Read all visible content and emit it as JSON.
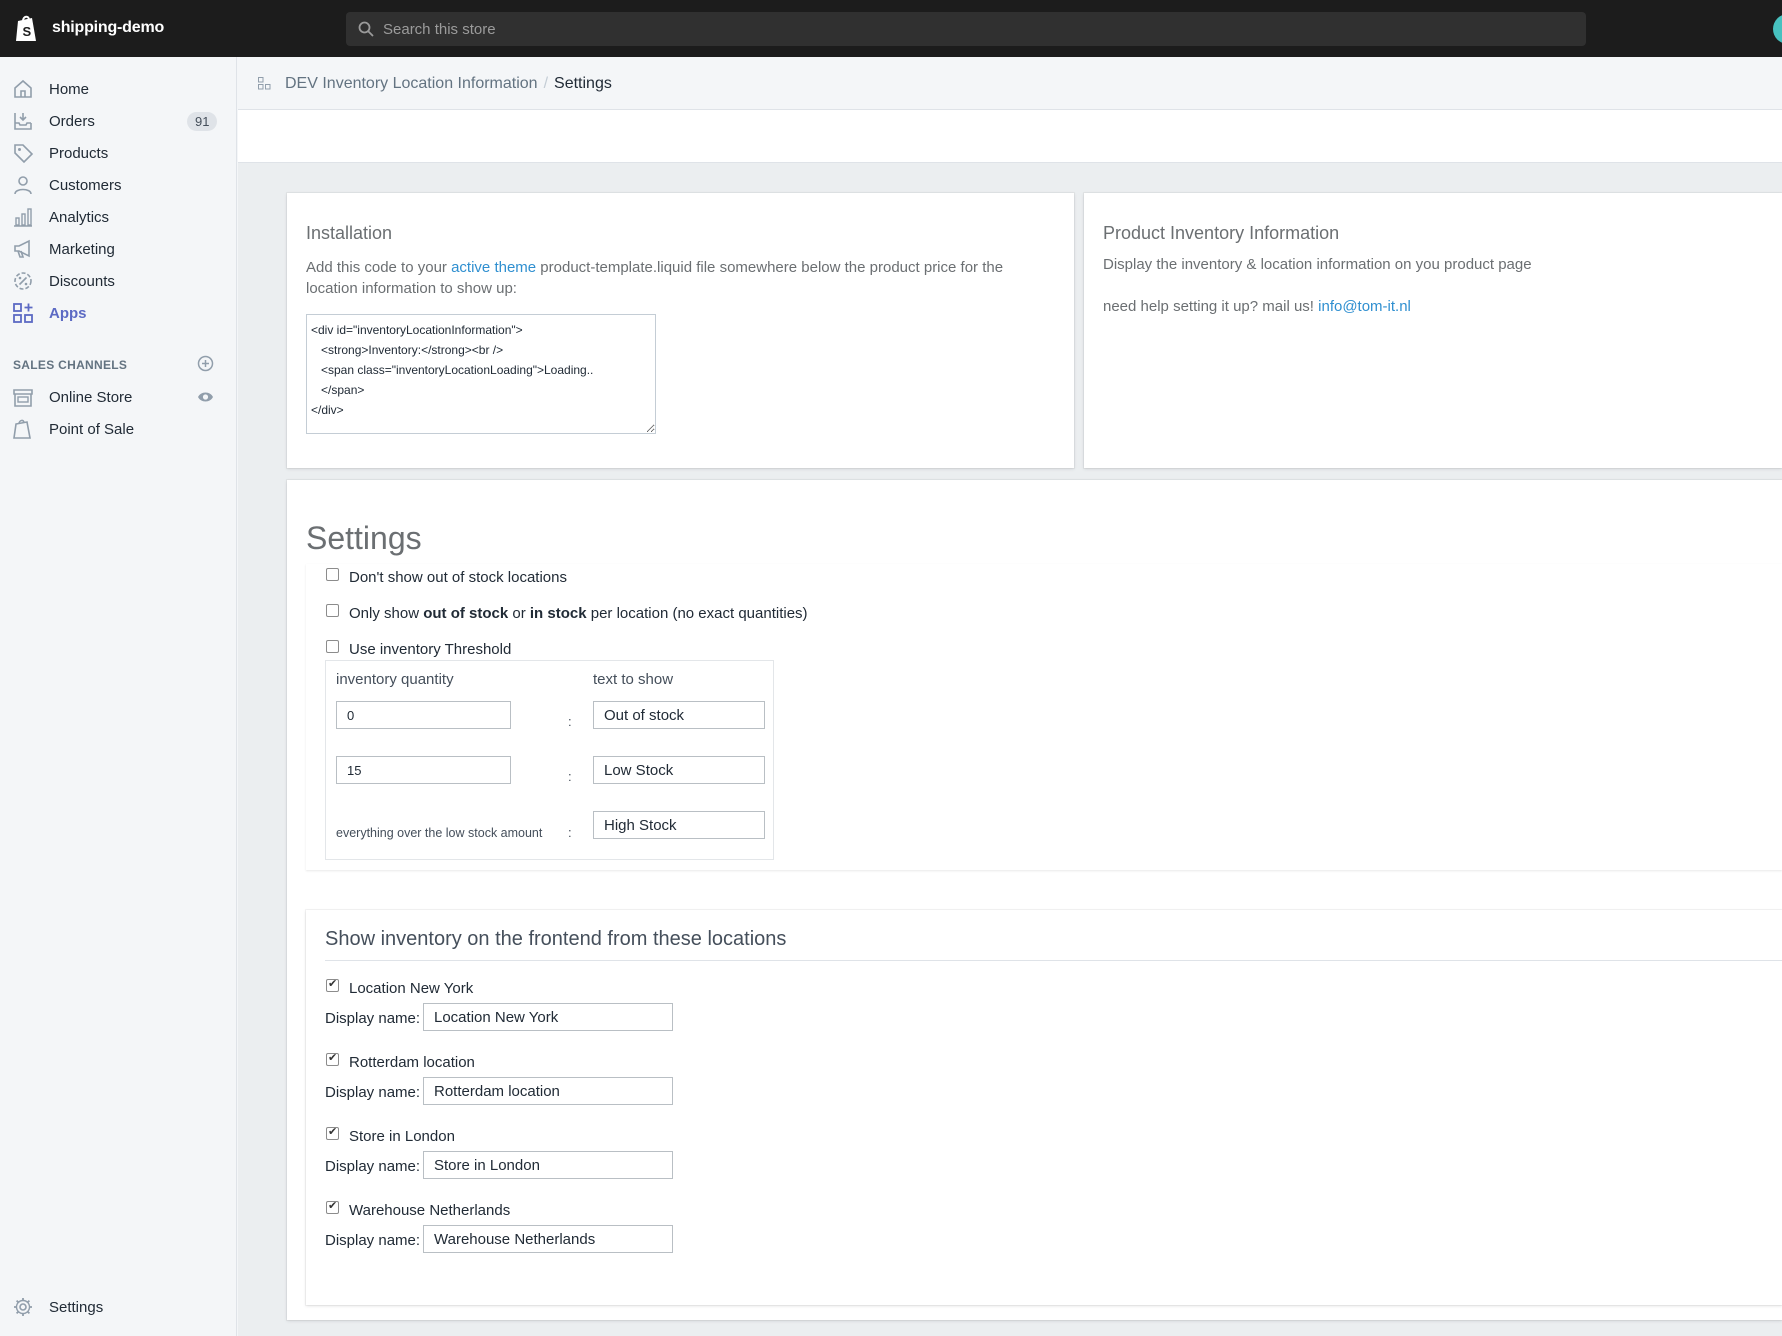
{
  "topbar": {
    "shop_name": "shipping-demo",
    "search_placeholder": "Search this store"
  },
  "sidebar": {
    "items": [
      {
        "label": "Home",
        "icon": "home-icon"
      },
      {
        "label": "Orders",
        "icon": "orders-icon",
        "badge": "91"
      },
      {
        "label": "Products",
        "icon": "tag-icon"
      },
      {
        "label": "Customers",
        "icon": "person-icon"
      },
      {
        "label": "Analytics",
        "icon": "bar-chart-icon"
      },
      {
        "label": "Marketing",
        "icon": "megaphone-icon"
      },
      {
        "label": "Discounts",
        "icon": "discount-icon"
      },
      {
        "label": "Apps",
        "icon": "apps-icon",
        "active": true
      }
    ],
    "sales_channels_heading": "SALES CHANNELS",
    "channels": [
      {
        "label": "Online Store",
        "icon": "store-icon"
      },
      {
        "label": "Point of Sale",
        "icon": "pos-bag-icon"
      }
    ],
    "settings_label": "Settings"
  },
  "breadcrumb": {
    "app": "DEV Inventory Location Information",
    "separator": "/",
    "current": "Settings"
  },
  "installation": {
    "title": "Installation",
    "text_before": "Add this code to your ",
    "link": "active theme",
    "text_after": " product-template.liquid file somewhere below the product price for the location information to show up:",
    "code": "<div id=\"inventoryLocationInformation\">\n   <strong>Inventory:</strong><br />\n   <span class=\"inventoryLocationLoading\">Loading..\n   </span>\n</div>"
  },
  "product_info": {
    "title": "Product Inventory Information",
    "description": "Display the inventory & location information on you product page",
    "help_text": "need help setting it up? mail us! ",
    "email": "info@tom-it.nl"
  },
  "settings": {
    "title": "Settings",
    "options": [
      {
        "label": "Don't show out of stock locations",
        "checked": false
      },
      {
        "parts": [
          "Only show ",
          "out of stock",
          " or ",
          "in stock",
          " per location (no exact quantities)"
        ],
        "checked": false
      },
      {
        "label": "Use inventory Threshold",
        "checked": false
      }
    ],
    "threshold": {
      "col_qty": "inventory quantity",
      "col_text": "text to show",
      "rows": [
        {
          "qty": "0",
          "text": "Out of stock"
        },
        {
          "qty": "15",
          "text": "Low Stock"
        }
      ],
      "over_label": "everything over the low stock amount",
      "over_text": "High Stock",
      "colon": ":"
    }
  },
  "locations": {
    "title": "Show inventory on the frontend from these locations",
    "display_name_label": "Display name:",
    "items": [
      {
        "name": "Location New York",
        "display_name": "Location New York",
        "checked": true
      },
      {
        "name": "Rotterdam location",
        "display_name": "Rotterdam location",
        "checked": true
      },
      {
        "name": "Store in London",
        "display_name": "Store in London",
        "checked": true
      },
      {
        "name": "Warehouse Netherlands",
        "display_name": "Warehouse Netherlands",
        "checked": true
      }
    ]
  },
  "colors": {
    "topbar": "#1c1c1c",
    "accent": "#5c6ac4",
    "link": "#2f8fd0"
  }
}
